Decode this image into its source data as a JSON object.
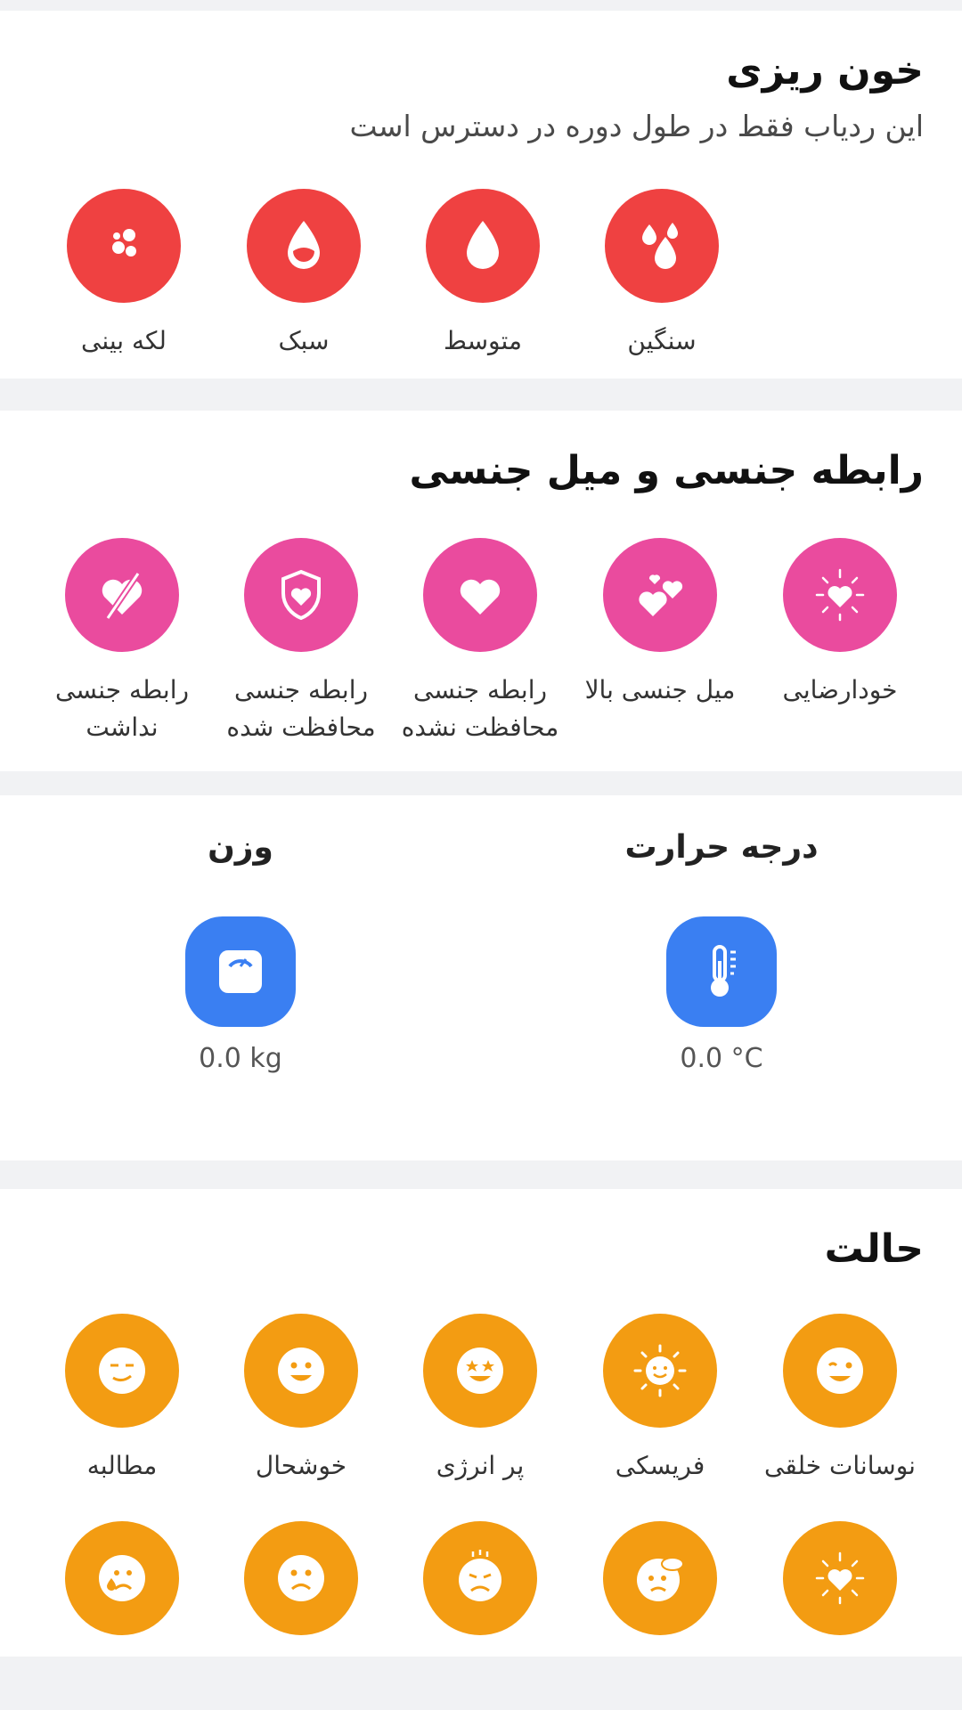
{
  "bleeding": {
    "title": "خون ریزی",
    "subtitle": "این ردیاب فقط در طول دوره در دسترس است",
    "items": [
      {
        "label": "سنگین",
        "icon": "drops-heavy-icon"
      },
      {
        "label": "متوسط",
        "icon": "drop-medium-icon"
      },
      {
        "label": "سبک",
        "icon": "drop-light-icon"
      },
      {
        "label": "لکه بینی",
        "icon": "spotting-icon"
      }
    ],
    "color": "#ef4141"
  },
  "sex": {
    "title": "رابطه جنسی و میل جنسی",
    "items": [
      {
        "label": "خودارضایی",
        "icon": "sparkle-heart-icon"
      },
      {
        "label": "میل جنسی بالا",
        "icon": "double-heart-icon"
      },
      {
        "label": "رابطه جنسی\nمحافظت نشده",
        "icon": "heart-icon"
      },
      {
        "label": "رابطه جنسی\nمحافظت شده",
        "icon": "shield-heart-icon"
      },
      {
        "label": "رابطه جنسی\nنداشت",
        "icon": "crossed-heart-icon"
      }
    ],
    "color": "#ea4b9e"
  },
  "metrics": {
    "temperature": {
      "title": "درجه حرارت",
      "value": "0.0 °C",
      "icon": "thermometer-icon"
    },
    "weight": {
      "title": "وزن",
      "value": "0.0 kg",
      "icon": "scale-icon"
    },
    "color": "#3a7ff2"
  },
  "mood": {
    "title": "حالت",
    "items": [
      {
        "label": "نوسانات خلقی",
        "icon": "wink-face-icon"
      },
      {
        "label": "فریسکی",
        "icon": "sun-face-icon"
      },
      {
        "label": "پر انرژی",
        "icon": "star-eyes-face-icon"
      },
      {
        "label": "خوشحال",
        "icon": "happy-face-icon"
      },
      {
        "label": "مطالبه",
        "icon": "smirk-face-icon"
      }
    ],
    "row2_icons": [
      "sparkle-heart-icon",
      "cloud-face-icon",
      "angry-face-icon",
      "sad-face-icon",
      "crying-face-icon"
    ],
    "color": "#f39c12"
  }
}
